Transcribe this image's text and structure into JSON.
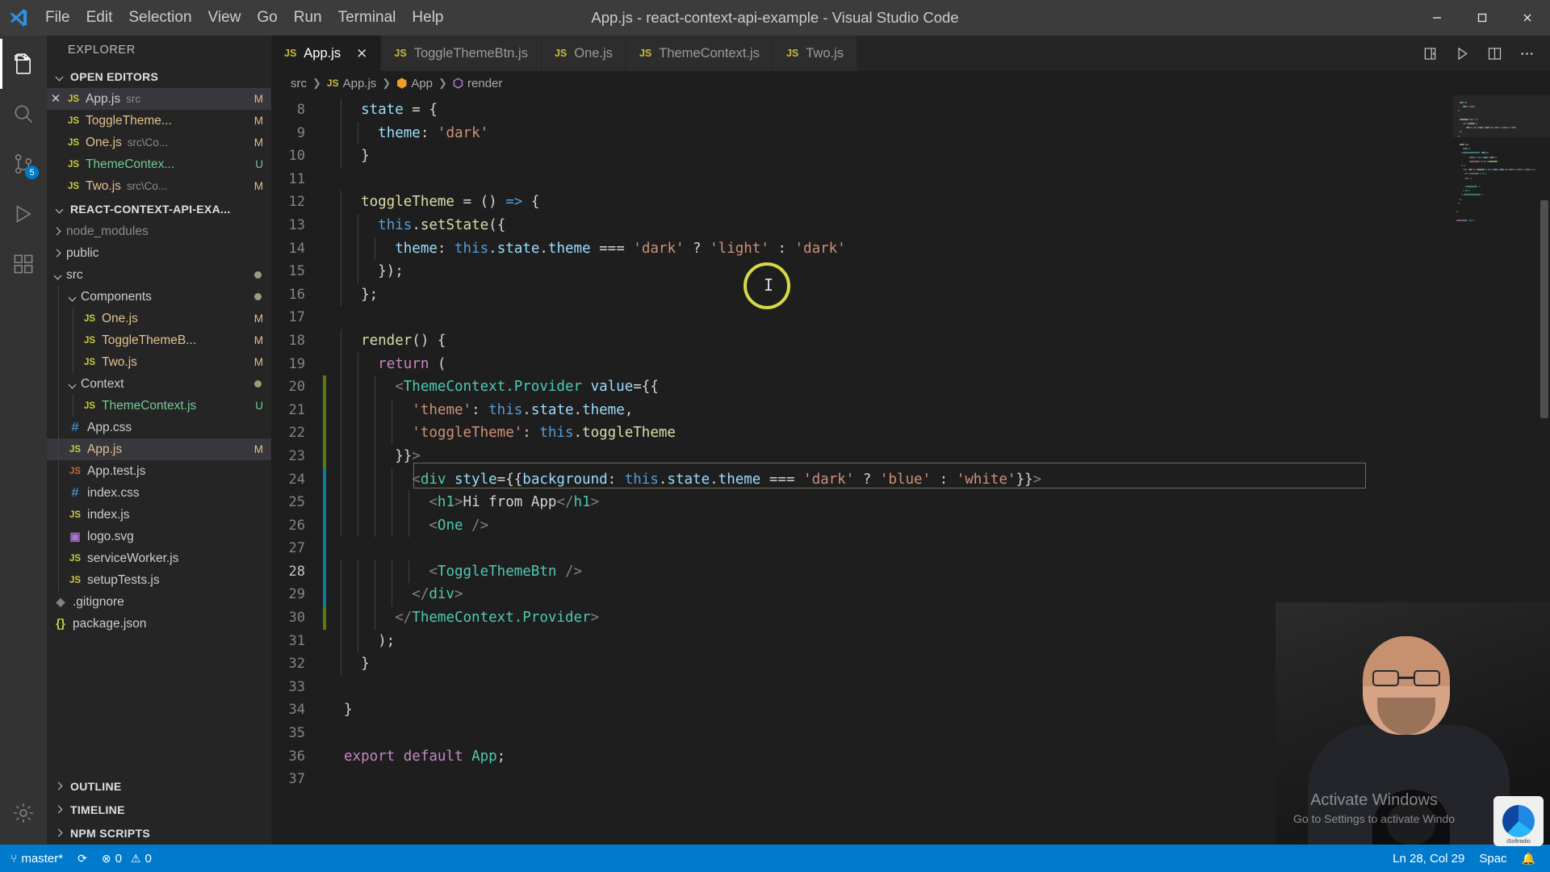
{
  "window": {
    "title": "App.js - react-context-api-example - Visual Studio Code",
    "menus": [
      "File",
      "Edit",
      "Selection",
      "View",
      "Go",
      "Run",
      "Terminal",
      "Help"
    ],
    "controls": {
      "minimize": "minimize-icon",
      "maximize": "maximize-icon",
      "close": "close-icon"
    }
  },
  "activitybar": {
    "items": [
      {
        "name": "explorer",
        "icon": "files-icon",
        "active": true,
        "badge": ""
      },
      {
        "name": "search",
        "icon": "search-icon",
        "active": false,
        "badge": ""
      },
      {
        "name": "source-control",
        "icon": "source-control-icon",
        "active": false,
        "badge": "5"
      },
      {
        "name": "run-and-debug",
        "icon": "debug-icon",
        "active": false,
        "badge": ""
      },
      {
        "name": "extensions",
        "icon": "extensions-icon",
        "active": false,
        "badge": ""
      },
      {
        "name": "manage",
        "icon": "gear-icon",
        "active": false,
        "badge": ""
      }
    ]
  },
  "sidebar": {
    "title": "EXPLORER",
    "sections": {
      "open_editors": {
        "label": "OPEN EDITORS",
        "expanded": true,
        "items": [
          {
            "name": "App.js",
            "path": "src",
            "badge": "M",
            "icon": "js",
            "active": true,
            "closable": true
          },
          {
            "name": "ToggleTheme...",
            "path": "",
            "badge": "M",
            "icon": "js",
            "active": false,
            "closable": false
          },
          {
            "name": "One.js",
            "path": "src\\Co...",
            "badge": "M",
            "icon": "js",
            "active": false,
            "closable": false
          },
          {
            "name": "ThemeContex...",
            "path": "",
            "badge": "U",
            "icon": "js",
            "active": false,
            "closable": false
          },
          {
            "name": "Two.js",
            "path": "src\\Co...",
            "badge": "M",
            "icon": "js",
            "active": false,
            "closable": false
          }
        ]
      },
      "project": {
        "label": "REACT-CONTEXT-API-EXA...",
        "expanded": true,
        "items": [
          {
            "name": "node_modules",
            "type": "folder",
            "expanded": false,
            "indent": 1,
            "dim": true,
            "badge": "",
            "icon": "folder"
          },
          {
            "name": "public",
            "type": "folder",
            "expanded": false,
            "indent": 1,
            "dim": false,
            "badge": "",
            "icon": "folder"
          },
          {
            "name": "src",
            "type": "folder",
            "expanded": true,
            "indent": 1,
            "dim": false,
            "badge": "dot",
            "icon": "folder"
          },
          {
            "name": "Components",
            "type": "folder",
            "expanded": true,
            "indent": 2,
            "dim": false,
            "badge": "dot",
            "icon": "folder"
          },
          {
            "name": "One.js",
            "type": "file",
            "indent": 3,
            "badge": "M",
            "icon": "js"
          },
          {
            "name": "ToggleThemeB...",
            "type": "file",
            "indent": 3,
            "badge": "M",
            "icon": "js"
          },
          {
            "name": "Two.js",
            "type": "file",
            "indent": 3,
            "badge": "M",
            "icon": "js"
          },
          {
            "name": "Context",
            "type": "folder",
            "expanded": true,
            "indent": 2,
            "badge": "dot",
            "icon": "folder"
          },
          {
            "name": "ThemeContext.js",
            "type": "file",
            "indent": 3,
            "badge": "U",
            "icon": "js"
          },
          {
            "name": "App.css",
            "type": "file",
            "indent": 2,
            "badge": "",
            "icon": "css"
          },
          {
            "name": "App.js",
            "type": "file",
            "indent": 2,
            "badge": "M",
            "icon": "js",
            "selected": true
          },
          {
            "name": "App.test.js",
            "type": "file",
            "indent": 2,
            "badge": "",
            "icon": "jstest"
          },
          {
            "name": "index.css",
            "type": "file",
            "indent": 2,
            "badge": "",
            "icon": "css"
          },
          {
            "name": "index.js",
            "type": "file",
            "indent": 2,
            "badge": "",
            "icon": "js"
          },
          {
            "name": "logo.svg",
            "type": "file",
            "indent": 2,
            "badge": "",
            "icon": "svg"
          },
          {
            "name": "serviceWorker.js",
            "type": "file",
            "indent": 2,
            "badge": "",
            "icon": "js"
          },
          {
            "name": "setupTests.js",
            "type": "file",
            "indent": 2,
            "badge": "",
            "icon": "js"
          },
          {
            "name": ".gitignore",
            "type": "file",
            "indent": 1,
            "badge": "",
            "icon": "git"
          },
          {
            "name": "package.json",
            "type": "file",
            "indent": 1,
            "badge": "",
            "icon": "json"
          }
        ]
      },
      "outline": {
        "label": "OUTLINE",
        "expanded": false
      },
      "timeline": {
        "label": "TIMELINE",
        "expanded": false
      },
      "npm_scripts": {
        "label": "NPM SCRIPTS",
        "expanded": false
      }
    }
  },
  "tabs": [
    {
      "label": "App.js",
      "icon": "js",
      "active": true,
      "closable": true
    },
    {
      "label": "ToggleThemeBtn.js",
      "icon": "js",
      "active": false,
      "closable": false
    },
    {
      "label": "One.js",
      "icon": "js",
      "active": false,
      "closable": false
    },
    {
      "label": "ThemeContext.js",
      "icon": "js",
      "active": false,
      "closable": false
    },
    {
      "label": "Two.js",
      "icon": "js",
      "active": false,
      "closable": false
    }
  ],
  "tab_actions": [
    {
      "name": "split-editor-right-icon"
    },
    {
      "name": "run-and-debug-icon"
    },
    {
      "name": "split-editor-icon"
    },
    {
      "name": "more-actions-icon"
    }
  ],
  "breadcrumb": [
    {
      "label": "src",
      "icon": ""
    },
    {
      "label": "App.js",
      "icon": "js"
    },
    {
      "label": "App",
      "icon": "class-icon"
    },
    {
      "label": "render",
      "icon": "method-icon"
    }
  ],
  "editor": {
    "first_line": 8,
    "cursor_ring": true,
    "lines": [
      {
        "n": 8,
        "change": "",
        "tokens": [
          [
            "t-plain",
            "  "
          ],
          [
            "t-var",
            "state"
          ],
          [
            "t-plain",
            " = {"
          ]
        ]
      },
      {
        "n": 9,
        "change": "",
        "tokens": [
          [
            "t-plain",
            "    "
          ],
          [
            "t-var",
            "theme"
          ],
          [
            "t-plain",
            ": "
          ],
          [
            "t-str",
            "'dark'"
          ]
        ]
      },
      {
        "n": 10,
        "change": "",
        "tokens": [
          [
            "t-plain",
            "  }"
          ]
        ]
      },
      {
        "n": 11,
        "change": "",
        "tokens": [
          [
            "t-plain",
            ""
          ]
        ]
      },
      {
        "n": 12,
        "change": "",
        "tokens": [
          [
            "t-plain",
            "  "
          ],
          [
            "t-fn",
            "toggleTheme"
          ],
          [
            "t-plain",
            " = () "
          ],
          [
            "t-key",
            "=>"
          ],
          [
            "t-plain",
            " {"
          ]
        ]
      },
      {
        "n": 13,
        "change": "",
        "tokens": [
          [
            "t-plain",
            "    "
          ],
          [
            "t-key",
            "this"
          ],
          [
            "t-plain",
            "."
          ],
          [
            "t-fn",
            "setState"
          ],
          [
            "t-plain",
            "({"
          ]
        ]
      },
      {
        "n": 14,
        "change": "",
        "tokens": [
          [
            "t-plain",
            "      "
          ],
          [
            "t-var",
            "theme"
          ],
          [
            "t-plain",
            ": "
          ],
          [
            "t-key",
            "this"
          ],
          [
            "t-plain",
            "."
          ],
          [
            "t-var",
            "state"
          ],
          [
            "t-plain",
            "."
          ],
          [
            "t-var",
            "theme"
          ],
          [
            "t-plain",
            " === "
          ],
          [
            "t-str",
            "'dark'"
          ],
          [
            "t-plain",
            " ? "
          ],
          [
            "t-str",
            "'light'"
          ],
          [
            "t-plain",
            " : "
          ],
          [
            "t-str",
            "'dark'"
          ]
        ]
      },
      {
        "n": 15,
        "change": "",
        "tokens": [
          [
            "t-plain",
            "    });"
          ]
        ]
      },
      {
        "n": 16,
        "change": "",
        "tokens": [
          [
            "t-plain",
            "  };"
          ]
        ]
      },
      {
        "n": 17,
        "change": "",
        "tokens": [
          [
            "t-plain",
            ""
          ]
        ]
      },
      {
        "n": 18,
        "change": "",
        "tokens": [
          [
            "t-plain",
            "  "
          ],
          [
            "t-fn",
            "render"
          ],
          [
            "t-plain",
            "() {"
          ]
        ]
      },
      {
        "n": 19,
        "change": "",
        "tokens": [
          [
            "t-plain",
            "    "
          ],
          [
            "t-ctl",
            "return"
          ],
          [
            "t-plain",
            " ("
          ]
        ]
      },
      {
        "n": 20,
        "change": "green",
        "tokens": [
          [
            "t-tagb",
            "      <"
          ],
          [
            "t-tag",
            "ThemeContext.Provider"
          ],
          [
            "t-plain",
            " "
          ],
          [
            "t-attr",
            "value"
          ],
          [
            "t-plain",
            "={{"
          ]
        ]
      },
      {
        "n": 21,
        "change": "green",
        "tokens": [
          [
            "t-plain",
            "        "
          ],
          [
            "t-str",
            "'theme'"
          ],
          [
            "t-plain",
            ": "
          ],
          [
            "t-key",
            "this"
          ],
          [
            "t-plain",
            "."
          ],
          [
            "t-var",
            "state"
          ],
          [
            "t-plain",
            "."
          ],
          [
            "t-var",
            "theme"
          ],
          [
            "t-plain",
            ","
          ]
        ]
      },
      {
        "n": 22,
        "change": "green",
        "tokens": [
          [
            "t-plain",
            "        "
          ],
          [
            "t-str",
            "'toggleTheme'"
          ],
          [
            "t-plain",
            ": "
          ],
          [
            "t-key",
            "this"
          ],
          [
            "t-plain",
            "."
          ],
          [
            "t-fn",
            "toggleTheme"
          ]
        ]
      },
      {
        "n": 23,
        "change": "green",
        "tokens": [
          [
            "t-plain",
            "      }}"
          ],
          [
            "t-tagb",
            ">"
          ]
        ]
      },
      {
        "n": 24,
        "change": "blue",
        "tokens": [
          [
            "t-tagb",
            "        <"
          ],
          [
            "t-tag",
            "div"
          ],
          [
            "t-plain",
            " "
          ],
          [
            "t-attr",
            "style"
          ],
          [
            "t-plain",
            "={{"
          ],
          [
            "t-var",
            "background"
          ],
          [
            "t-plain",
            ": "
          ],
          [
            "t-key",
            "this"
          ],
          [
            "t-plain",
            "."
          ],
          [
            "t-var",
            "state"
          ],
          [
            "t-plain",
            "."
          ],
          [
            "t-var",
            "theme"
          ],
          [
            "t-plain",
            " === "
          ],
          [
            "t-str",
            "'dark'"
          ],
          [
            "t-plain",
            " ? "
          ],
          [
            "t-str",
            "'blue'"
          ],
          [
            "t-plain",
            " : "
          ],
          [
            "t-str",
            "'white'"
          ],
          [
            "t-plain",
            "}}"
          ],
          [
            "t-tagb",
            ">"
          ]
        ]
      },
      {
        "n": 25,
        "change": "blue",
        "tokens": [
          [
            "t-tagb",
            "          <"
          ],
          [
            "t-tag",
            "h1"
          ],
          [
            "t-tagb",
            ">"
          ],
          [
            "t-plain",
            "Hi from App"
          ],
          [
            "t-tagb",
            "</"
          ],
          [
            "t-tag",
            "h1"
          ],
          [
            "t-tagb",
            ">"
          ]
        ]
      },
      {
        "n": 26,
        "change": "blue",
        "tokens": [
          [
            "t-tagb",
            "          <"
          ],
          [
            "t-tag",
            "One"
          ],
          [
            "t-plain",
            " "
          ],
          [
            "t-tagb",
            "/>"
          ]
        ]
      },
      {
        "n": 27,
        "change": "blue",
        "tokens": [
          [
            "t-plain",
            ""
          ]
        ]
      },
      {
        "n": 28,
        "change": "blue",
        "tokens": [
          [
            "t-tagb",
            "          <"
          ],
          [
            "t-tag",
            "ToggleThemeBtn"
          ],
          [
            "t-plain",
            " "
          ],
          [
            "t-tagb",
            "/>"
          ]
        ]
      },
      {
        "n": 29,
        "change": "blue",
        "tokens": [
          [
            "t-tagb",
            "        </"
          ],
          [
            "t-tag",
            "div"
          ],
          [
            "t-tagb",
            ">"
          ]
        ]
      },
      {
        "n": 30,
        "change": "green",
        "tokens": [
          [
            "t-tagb",
            "      </"
          ],
          [
            "t-tag",
            "ThemeContext.Provider"
          ],
          [
            "t-tagb",
            ">"
          ]
        ]
      },
      {
        "n": 31,
        "change": "",
        "tokens": [
          [
            "t-plain",
            "    );"
          ]
        ]
      },
      {
        "n": 32,
        "change": "",
        "tokens": [
          [
            "t-plain",
            "  }"
          ]
        ]
      },
      {
        "n": 33,
        "change": "",
        "tokens": [
          [
            "t-plain",
            ""
          ]
        ]
      },
      {
        "n": 34,
        "change": "",
        "tokens": [
          [
            "t-plain",
            "}"
          ]
        ]
      },
      {
        "n": 35,
        "change": "",
        "tokens": [
          [
            "t-plain",
            ""
          ]
        ]
      },
      {
        "n": 36,
        "change": "",
        "tokens": [
          [
            "t-ctl",
            "export default"
          ],
          [
            "t-plain",
            " "
          ],
          [
            "t-tag",
            "App"
          ],
          [
            "t-plain",
            ";"
          ]
        ]
      },
      {
        "n": 37,
        "change": "",
        "tokens": [
          [
            "t-plain",
            ""
          ]
        ]
      }
    ]
  },
  "statusbar": {
    "branch": "master*",
    "sync_icon": "sync-icon",
    "errors": "0",
    "warnings": "0",
    "position": "Ln 28, Col 29",
    "indentation": "Spac",
    "encoding": "",
    "language": "",
    "bell_icon": "bell-icon"
  },
  "overlays": {
    "activate_windows_title": "Activate Windows",
    "activate_windows_sub": "Go to Settings to activate Windo",
    "logo_text": "iSoftradio"
  },
  "colors": {
    "accent": "#007acc",
    "titlebar_bg": "#3c3c3c",
    "sidebar_bg": "#252526",
    "editor_bg": "#1e1e1e",
    "activitybar_bg": "#333333",
    "modified_badge": "#e2c08d",
    "untracked_badge": "#73c991",
    "cursor_ring": "#e8e84a"
  }
}
